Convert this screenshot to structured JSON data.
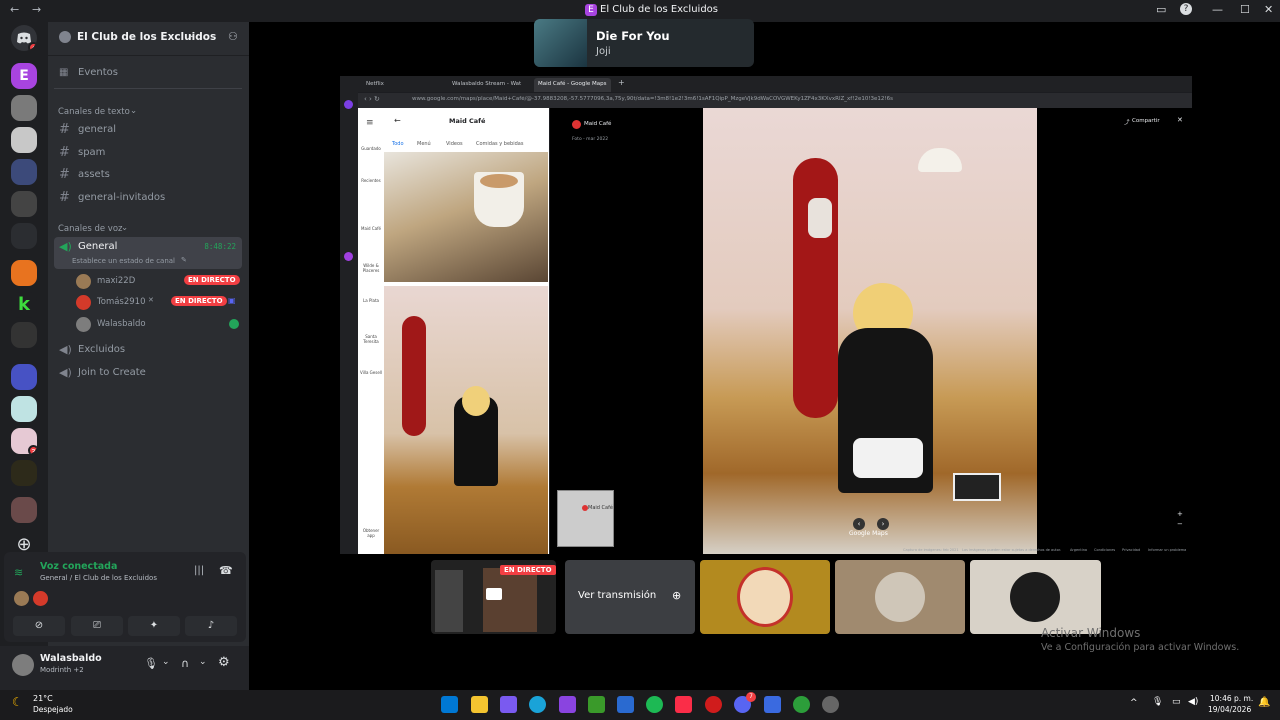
{
  "window": {
    "title": "El Club de los Excluidos",
    "title_icon": "E"
  },
  "server": {
    "name": "El Club de los Excluidos",
    "events_label": "Eventos",
    "text_category": "Canales de texto",
    "text_channels": [
      "general",
      "spam",
      "assets",
      "general-invitados"
    ],
    "voice_category": "Canales de voz",
    "voice_channel": {
      "name": "General",
      "timer": "8:48:22",
      "status": "Establece un estado de canal"
    },
    "voice_users": [
      {
        "name": "maxi22D",
        "live": "EN DIRECTO"
      },
      {
        "name": "Tomás2910",
        "live": "EN DIRECTO"
      },
      {
        "name": "Walasbaldo",
        "live": ""
      }
    ],
    "other_voice": [
      "Excluidos",
      "Join to Create"
    ]
  },
  "voice_panel": {
    "status": "Voz conectada",
    "location": "General / El Club de los Excluidos"
  },
  "user_panel": {
    "name": "Walasbaldo",
    "sub": "Modrinth +2"
  },
  "server_badges": [
    "4",
    "3"
  ],
  "toast": {
    "title": "Die For You",
    "artist": "Joji"
  },
  "browser": {
    "tabs": [
      "Netflix",
      "Walasbaldo Stream - Wat",
      "Maid Café - Google Maps"
    ],
    "url": "www.google.com/maps/place/Maid+Café/@-37.9883208,-57.5777096,3a,75y,90t/data=!3m8!1e2!3m6!1sAF1QipP_MzgeVJk9dWaCOVGWEKy1ZF4x3KXvxRlZ_xf!2e10!3e12!6s",
    "place": "Maid Café",
    "place_tabs": [
      "Todo",
      "Menú",
      "Videos",
      "Comidas y bebidas"
    ],
    "share_label": "Compartir",
    "photo_date": "Foto - mar 2022",
    "rail": [
      "Guardado",
      "Recientes",
      "Maid Café",
      "Wilde & Placeres",
      "La Plata",
      "Santa Teresita",
      "Villa Gesell",
      "Obtener app"
    ],
    "minimap_label": "Maid Café",
    "footer": [
      "Captura de imágenes: feb 2021",
      "Las imágenes pueden estar sujetas a derechos de autor.",
      "Argentina",
      "Condiciones",
      "Privacidad",
      "Informar un problema"
    ],
    "google_label": "Google Maps"
  },
  "stream_strip": {
    "live_label": "EN DIRECTO",
    "watch_label": "Ver transmisión"
  },
  "watermark": {
    "line1": "Activar Windows",
    "line2": "Ve a Configuración para activar Windows."
  },
  "taskbar": {
    "temp": "21°C",
    "weather": "Despejado",
    "time": "10:46 p. m.",
    "date": "19/04/2026",
    "discord_badge": "7"
  },
  "colors": {
    "accent": "#5865f2",
    "live": "#f23f43",
    "voice_green": "#23a55a",
    "sidebar": "#2b2d31",
    "rail": "#1e1f22"
  }
}
